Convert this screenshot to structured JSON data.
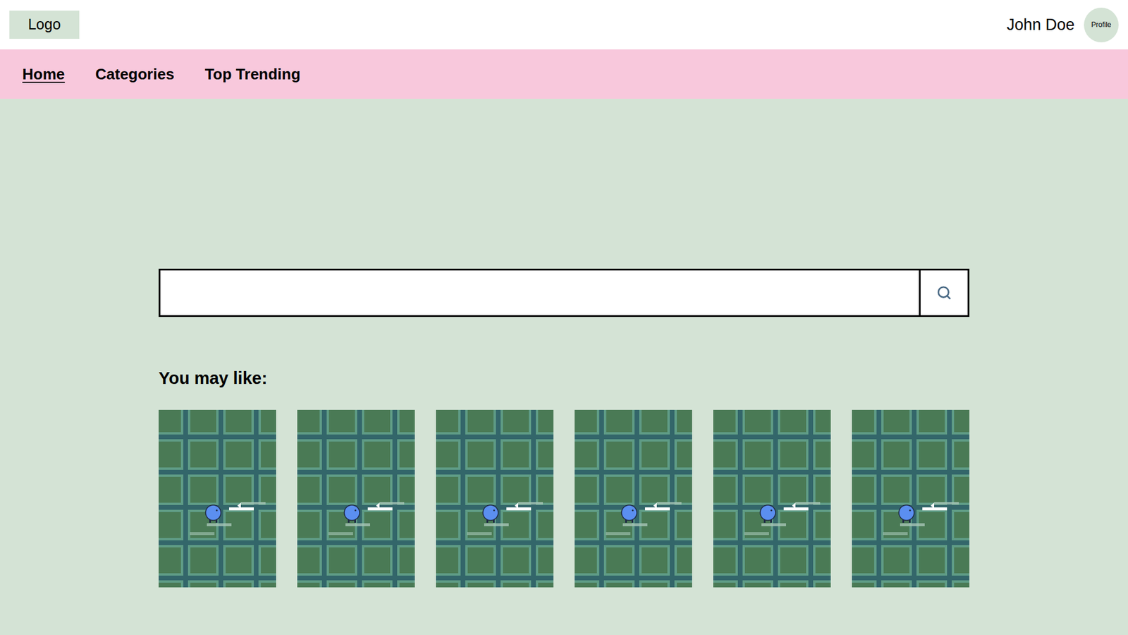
{
  "header": {
    "logo": "Logo",
    "user_name": "John Doe",
    "profile": "Profile"
  },
  "nav": [
    {
      "label": "Home",
      "selected": true
    },
    {
      "label": "Categories",
      "selected": false
    },
    {
      "label": "Top Trending",
      "selected": false
    }
  ],
  "search": {
    "placeholder": "",
    "value": ""
  },
  "recommendations": {
    "title": "You may like:",
    "items": [
      {
        "kind": "thumbnail"
      },
      {
        "kind": "thumbnail"
      },
      {
        "kind": "thumbnail"
      },
      {
        "kind": "thumbnail"
      },
      {
        "kind": "thumbnail"
      },
      {
        "kind": "thumbnail"
      }
    ]
  }
}
